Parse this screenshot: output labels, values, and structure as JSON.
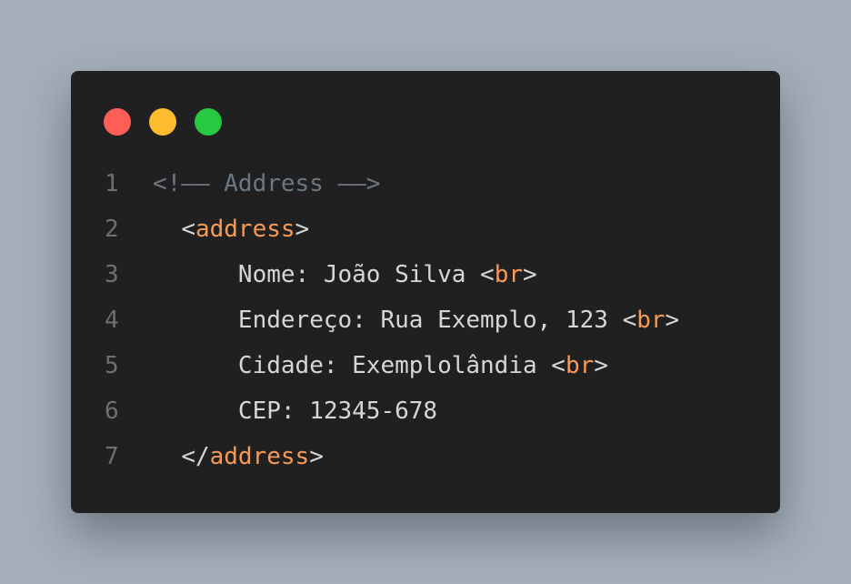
{
  "window": {
    "controls": [
      {
        "name": "close-button",
        "color": "#ff5f57"
      },
      {
        "name": "minimize-button",
        "color": "#febc2e"
      },
      {
        "name": "maximize-button",
        "color": "#28c840"
      }
    ]
  },
  "colors": {
    "background": "#a4afba",
    "editor": "#202020",
    "line_number": "#6f6f6f",
    "comment": "#6e7780",
    "punctuation": "#d6d6d6",
    "tag": "#f69a5a",
    "text": "#d6d6d6"
  },
  "code_lines": [
    {
      "number": "1",
      "indent": "",
      "tokens": [
        {
          "t": "<!—— Address ——>",
          "k": "comment"
        }
      ]
    },
    {
      "number": "2",
      "indent": "  ",
      "tokens": [
        {
          "t": "<",
          "k": "punctuation"
        },
        {
          "t": "address",
          "k": "tag"
        },
        {
          "t": ">",
          "k": "punctuation"
        }
      ]
    },
    {
      "number": "3",
      "indent": "      ",
      "tokens": [
        {
          "t": "Nome: João Silva ",
          "k": "text"
        },
        {
          "t": "<",
          "k": "punctuation"
        },
        {
          "t": "br",
          "k": "tag"
        },
        {
          "t": ">",
          "k": "punctuation"
        }
      ]
    },
    {
      "number": "4",
      "indent": "      ",
      "tokens": [
        {
          "t": "Endereço: Rua Exemplo, 123 ",
          "k": "text"
        },
        {
          "t": "<",
          "k": "punctuation"
        },
        {
          "t": "br",
          "k": "tag"
        },
        {
          "t": ">",
          "k": "punctuation"
        }
      ]
    },
    {
      "number": "5",
      "indent": "      ",
      "tokens": [
        {
          "t": "Cidade: Exemplolândia ",
          "k": "text"
        },
        {
          "t": "<",
          "k": "punctuation"
        },
        {
          "t": "br",
          "k": "tag"
        },
        {
          "t": ">",
          "k": "punctuation"
        }
      ]
    },
    {
      "number": "6",
      "indent": "      ",
      "tokens": [
        {
          "t": "CEP: 12345-678",
          "k": "text"
        }
      ]
    },
    {
      "number": "7",
      "indent": "  ",
      "tokens": [
        {
          "t": "</",
          "k": "punctuation"
        },
        {
          "t": "address",
          "k": "tag"
        },
        {
          "t": ">",
          "k": "punctuation"
        }
      ]
    }
  ]
}
